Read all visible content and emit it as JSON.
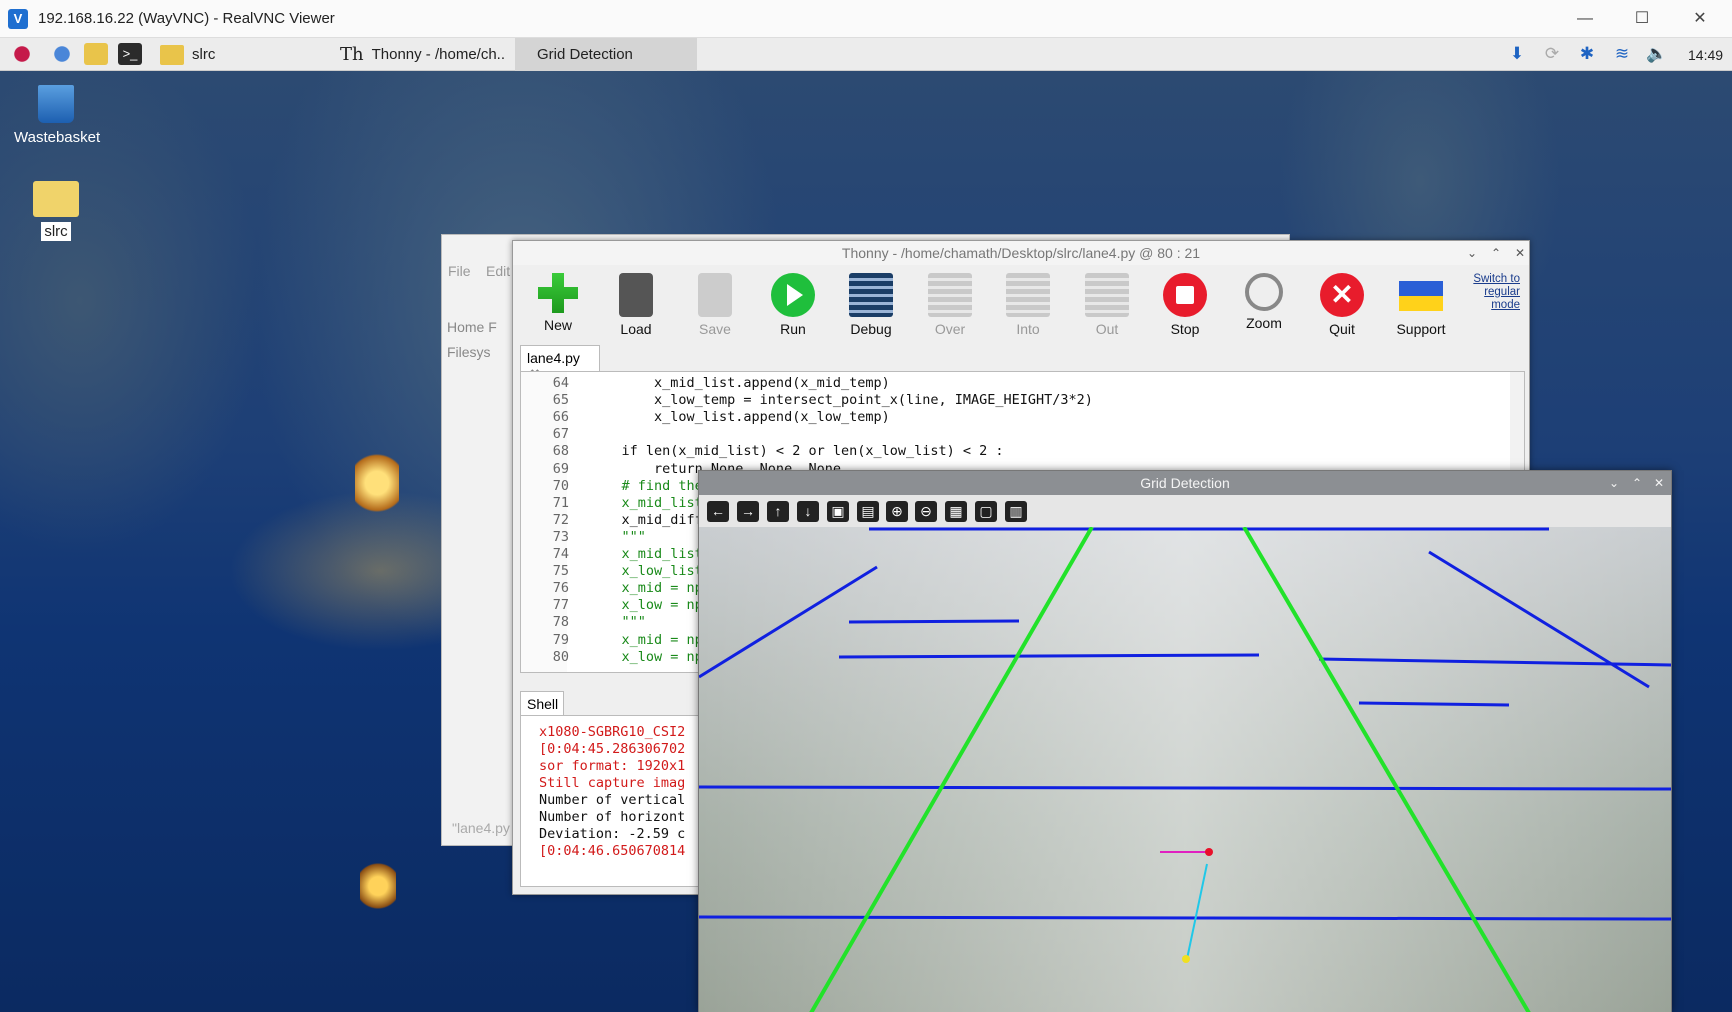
{
  "vnc": {
    "title": "192.168.16.22 (WayVNC) - RealVNC Viewer",
    "min": "—",
    "max": "☐",
    "close": "✕"
  },
  "taskbar": {
    "folder_label": "slrc",
    "thonny_label": "Thonny  -  /home/ch..",
    "grid_label": "Grid Detection",
    "clock": "14:49"
  },
  "desktop": {
    "wastebasket": "Wastebasket",
    "folder": "slrc"
  },
  "fm": {
    "menu_file": "File",
    "menu_edit": "Edit",
    "home": "Home F",
    "filesys": "Filesys",
    "status": "\"lane4.py"
  },
  "thonny": {
    "title": "Thonny  -  /home/chamath/Desktop/slrc/lane4.py  @  80 : 21",
    "tools": [
      "New",
      "Load",
      "Save",
      "Run",
      "Debug",
      "Over",
      "Into",
      "Out",
      "Stop",
      "Zoom",
      "Quit",
      "Support"
    ],
    "switch_mode": [
      "Switch to",
      "regular",
      "mode"
    ],
    "tab": "lane4.py",
    "line_numbers": [
      "64",
      "65",
      "66",
      "67",
      "68",
      "69",
      "70",
      "71",
      "72",
      "73",
      "74",
      "75",
      "76",
      "77",
      "78",
      "79",
      "80"
    ],
    "code_lines": [
      "        x_mid_list.append(x_mid_temp)",
      "        x_low_temp = intersect_point_x(line, IMAGE_HEIGHT/3*2)",
      "        x_low_list.append(x_low_temp)",
      "",
      "    if len(x_mid_list) < 2 or len(x_low_list) < 2 :",
      "        return None, None, None",
      "    # find the",
      "    x_mid_list",
      "    x_mid_diff",
      "    \"\"\"",
      "    x_mid_list",
      "    x_low_list",
      "    x_mid = np",
      "    x_low = np",
      "    \"\"\"",
      "    x_mid = np",
      "    x_low = np"
    ],
    "shell_tab": "Shell",
    "shell_lines": [
      "x1080-SGBRG10_CSI2",
      "[0:04:45.286306702",
      "sor format: 1920x1",
      "Still capture imag",
      "Number of vertical",
      "Number of horizont",
      "Deviation: -2.59 c",
      "[0:04:46.650670814"
    ]
  },
  "grid": {
    "title": "Grid Detection"
  },
  "colors": {
    "accent": "#1e63c2",
    "green_line": "#22e22a",
    "blue_line": "#1020e0"
  }
}
